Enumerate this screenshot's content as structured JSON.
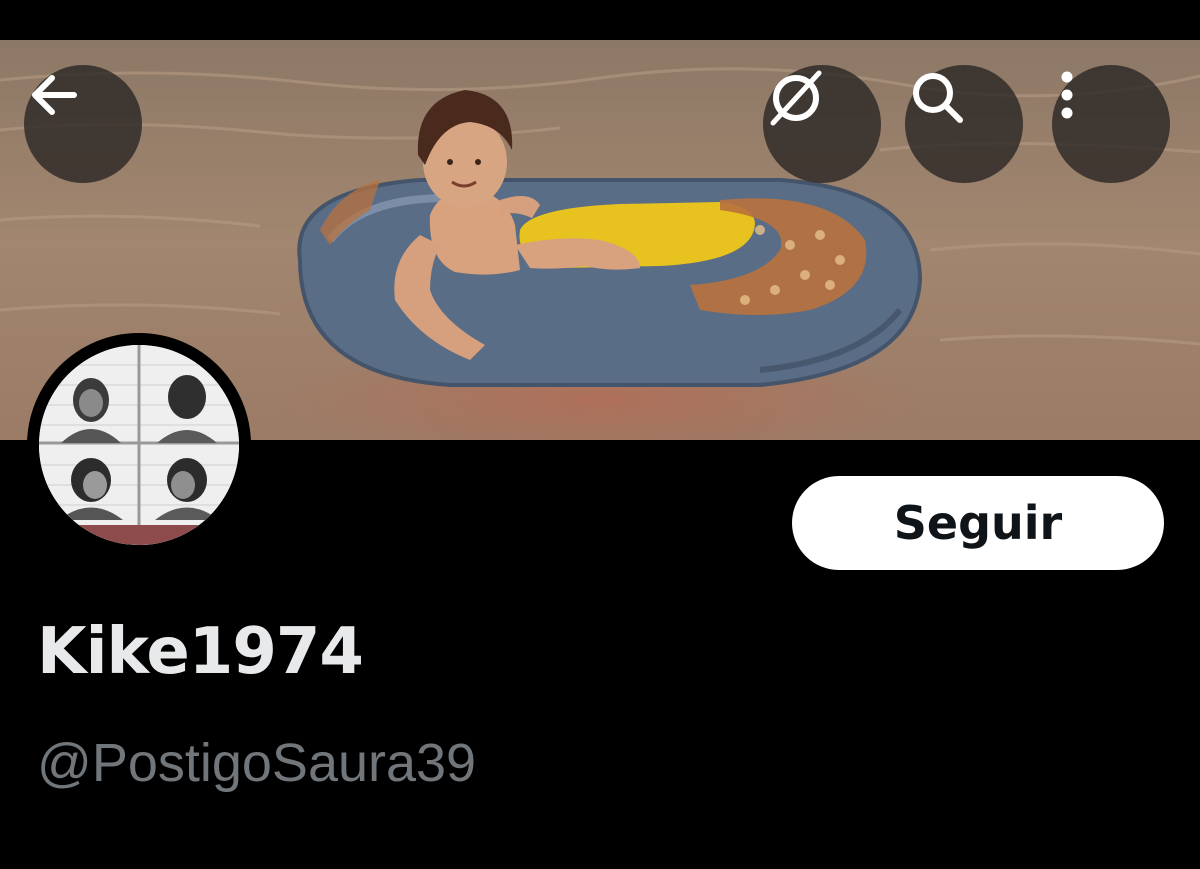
{
  "header": {
    "back_icon": "arrow-left-icon",
    "translate_icon": "slashed-circle-icon",
    "search_icon": "search-icon",
    "more_icon": "vertical-dots-icon"
  },
  "profile": {
    "display_name": "Kike1974",
    "handle": "@PostigoSaura39",
    "follow_label": "Seguir"
  },
  "colors": {
    "background": "#000000",
    "name_text": "#e7e9ea",
    "handle_text": "#71767b",
    "follow_button_bg": "#ffffff",
    "follow_button_text": "#0f1419",
    "overlay_button_bg": "#282422"
  }
}
